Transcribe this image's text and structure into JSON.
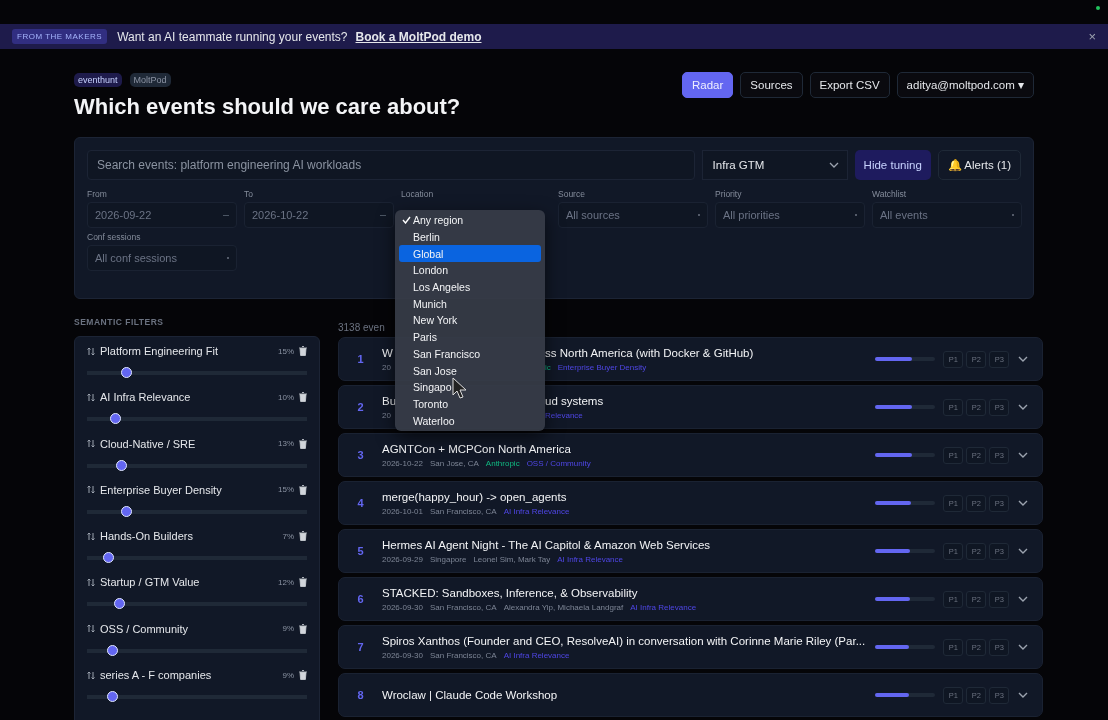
{
  "banner": {
    "badge": "FROM THE MAKERS",
    "text": "Want an AI teammate running your events?",
    "link": "Book a MoltPod demo",
    "close": "×"
  },
  "header": {
    "tags": [
      {
        "label": "eventhunt",
        "kind": "primary"
      },
      {
        "label": "MoltPod",
        "kind": "muted"
      }
    ],
    "title": "Which events should we care about?",
    "nav": [
      {
        "label": "Radar",
        "selected": true
      },
      {
        "label": "Sources",
        "selected": false
      },
      {
        "label": "Export CSV",
        "selected": false
      },
      {
        "label": "aditya@moltpod.com ▾",
        "selected": false
      }
    ]
  },
  "filters": {
    "search": {
      "placeholder": "Search events: platform engineering AI workloads"
    },
    "profile": "Infra GTM",
    "hide_tuning": "Hide tuning",
    "alerts": "🔔 Alerts (1)",
    "fields": [
      {
        "label": "From",
        "value": "2026-09-22",
        "kind": "date"
      },
      {
        "label": "To",
        "value": "2026-10-22",
        "kind": "date"
      },
      {
        "label": "Location",
        "kind": "covered"
      },
      {
        "label": "Source",
        "value": "All sources",
        "kind": "select"
      },
      {
        "label": "Priority",
        "value": "All priorities",
        "kind": "select"
      },
      {
        "label": "Watchlist",
        "value": "All events",
        "kind": "select"
      },
      {
        "label": "Conf sessions",
        "value": "All conf sessions",
        "kind": "select"
      }
    ]
  },
  "location_menu": [
    {
      "label": "Any region",
      "checked": true,
      "selected": false
    },
    {
      "label": "Berlin",
      "checked": false,
      "selected": false
    },
    {
      "label": "Global",
      "checked": false,
      "selected": true
    },
    {
      "label": "London",
      "checked": false,
      "selected": false
    },
    {
      "label": "Los Angeles",
      "checked": false,
      "selected": false
    },
    {
      "label": "Munich",
      "checked": false,
      "selected": false
    },
    {
      "label": "New York",
      "checked": false,
      "selected": false
    },
    {
      "label": "Paris",
      "checked": false,
      "selected": false
    },
    {
      "label": "San Francisco",
      "checked": false,
      "selected": false
    },
    {
      "label": "San Jose",
      "checked": false,
      "selected": false
    },
    {
      "label": "Singapo",
      "checked": false,
      "selected": false
    },
    {
      "label": "Toronto",
      "checked": false,
      "selected": false
    },
    {
      "label": "Waterloo",
      "checked": false,
      "selected": false
    }
  ],
  "semantic_filters": {
    "heading": "SEMANTIC FILTERS",
    "items": [
      {
        "name": "Platform Engineering Fit",
        "weight": "15%",
        "level": 0.18
      },
      {
        "name": "AI Infra Relevance",
        "weight": "10%",
        "level": 0.13
      },
      {
        "name": "Cloud-Native / SRE",
        "weight": "13%",
        "level": 0.16
      },
      {
        "name": "Enterprise Buyer Density",
        "weight": "15%",
        "level": 0.18
      },
      {
        "name": "Hands-On Builders",
        "weight": "7%",
        "level": 0.1
      },
      {
        "name": "Startup / GTM Value",
        "weight": "12%",
        "level": 0.15
      },
      {
        "name": "OSS / Community",
        "weight": "9%",
        "level": 0.12
      },
      {
        "name": "series A - F companies",
        "weight": "9%",
        "level": 0.12
      }
    ]
  },
  "events": {
    "count": "3138 even",
    "rows": [
      {
        "rank": "1",
        "title": [
          "W",
          "ss North America (with Docker & GitHub)"
        ],
        "meta": [
          [
            {
              "text": "20",
              "kind": "plain"
            }
          ],
          [
            {
              "text": "ic",
              "kind": "org"
            },
            {
              "text": "Enterprise Buyer Density",
              "kind": "tag"
            }
          ]
        ],
        "level": 0.62,
        "priorities": [
          "P1",
          "P2",
          "P3"
        ]
      },
      {
        "rank": "2",
        "title": [
          "Bu",
          "ud systems"
        ],
        "meta": [
          [
            {
              "text": "20",
              "kind": "plain"
            }
          ],
          [
            {
              "text": "Relevance",
              "kind": "tag"
            }
          ]
        ],
        "level": 0.62,
        "priorities": [
          "P1",
          "P2",
          "P3"
        ]
      },
      {
        "rank": "3",
        "title": [
          "AGNTCon + MCPCon North America"
        ],
        "meta": [
          [
            {
              "text": "2026-10-22",
              "kind": "plain"
            },
            {
              "text": "San Jose, CA",
              "kind": "plain"
            },
            {
              "text": "Anthropic",
              "kind": "org"
            },
            {
              "text": "OSS / Community",
              "kind": "tag"
            }
          ]
        ],
        "level": 0.62,
        "priorities": [
          "P1",
          "P2",
          "P3"
        ]
      },
      {
        "rank": "4",
        "title": [
          "merge(happy_hour) -> open_agents"
        ],
        "meta": [
          [
            {
              "text": "2026-10-01",
              "kind": "plain"
            },
            {
              "text": "San Francisco, CA",
              "kind": "plain"
            },
            {
              "text": "AI Infra Relevance",
              "kind": "tag"
            }
          ]
        ],
        "level": 0.6,
        "priorities": [
          "P1",
          "P2",
          "P3"
        ]
      },
      {
        "rank": "5",
        "title": [
          "Hermes AI Agent Night - The AI Capitol & Amazon Web Services"
        ],
        "meta": [
          [
            {
              "text": "2026-09-29",
              "kind": "plain"
            },
            {
              "text": "Singapore",
              "kind": "plain"
            },
            {
              "text": "Leonel Sim, Mark Tay",
              "kind": "plain"
            },
            {
              "text": "AI Infra Relevance",
              "kind": "tag"
            }
          ]
        ],
        "level": 0.58,
        "priorities": [
          "P1",
          "P2",
          "P3"
        ]
      },
      {
        "rank": "6",
        "title": [
          "STACKED: Sandboxes, Inference, & Observability"
        ],
        "meta": [
          [
            {
              "text": "2026-09-30",
              "kind": "plain"
            },
            {
              "text": "San Francisco, CA",
              "kind": "plain"
            },
            {
              "text": "Alexandra Yip, Michaela Landgraf",
              "kind": "plain"
            },
            {
              "text": "AI Infra Relevance",
              "kind": "tag"
            }
          ]
        ],
        "level": 0.58,
        "priorities": [
          "P1",
          "P2",
          "P3"
        ]
      },
      {
        "rank": "7",
        "title": [
          "Spiros Xanthos (Founder and CEO, ResolveAI) in conversation with Corinne Marie Riley (Par..."
        ],
        "meta": [
          [
            {
              "text": "2026-09-30",
              "kind": "plain"
            },
            {
              "text": "San Francisco, CA",
              "kind": "plain"
            },
            {
              "text": "AI Infra Relevance",
              "kind": "tag"
            }
          ]
        ],
        "level": 0.57,
        "priorities": [
          "P1",
          "P2",
          "P3"
        ]
      },
      {
        "rank": "8",
        "title": [
          "Wroclaw | Claude Code Workshop"
        ],
        "meta": [],
        "level": 0.56,
        "priorities": [
          "P1",
          "P2",
          "P3"
        ]
      }
    ]
  }
}
